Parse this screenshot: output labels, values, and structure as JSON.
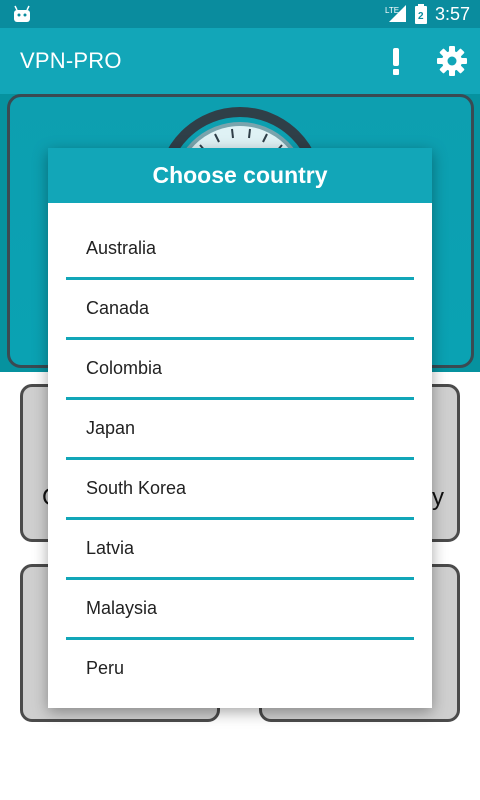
{
  "status_bar": {
    "network": "LTE",
    "battery_level": "2",
    "time": "3:57"
  },
  "app_bar": {
    "title": "VPN-PRO"
  },
  "background": {
    "left_card_text": "C",
    "right_card_text": "y"
  },
  "dialog": {
    "title": "Choose country",
    "countries": [
      "Australia",
      "Canada",
      "Colombia",
      "Japan",
      "South Korea",
      "Latvia",
      "Malaysia",
      "Peru"
    ]
  },
  "colors": {
    "primary": "#12a6b8",
    "primary_dark": "#0a8c9e"
  }
}
